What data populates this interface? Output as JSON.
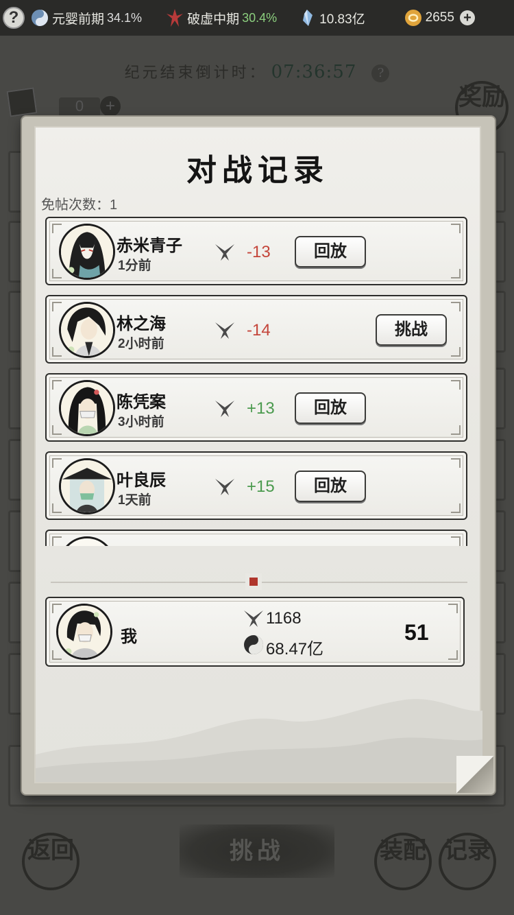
{
  "topbar": {
    "help_label": "?",
    "realm": {
      "label": "元婴前期",
      "percent": "34.1%",
      "icon": "yin-yang-icon"
    },
    "break": {
      "label": "破虚中期",
      "percent": "30.4%",
      "icon": "red-flame-icon"
    },
    "spirit_stone": {
      "value": "10.83亿",
      "icon": "crystal-icon"
    },
    "coins": {
      "value": "2655",
      "icon": "gold-coin-icon"
    },
    "plus_label": "+"
  },
  "background": {
    "countdown_label": "纪元结束倒计时：",
    "countdown_time": "07:36:57",
    "help_label": "?",
    "ticket_count": "0",
    "ticket_plus": "+",
    "reward_label": "奖励",
    "back_label": "返回",
    "challenge_label": "挑战",
    "equip_label": "装配",
    "records_label": "记录"
  },
  "modal": {
    "title": "对战记录",
    "free_label": "免帖次数：",
    "free_count": "1",
    "records": [
      {
        "name": "赤米青子",
        "time": "1分前",
        "delta": "-13",
        "sign": "neg",
        "action": "回放",
        "avatar": "fox-mask-avatar"
      },
      {
        "name": "林之海",
        "time": "2小时前",
        "delta": "-14",
        "sign": "neg",
        "action": "挑战",
        "avatar": "swordsman-avatar"
      },
      {
        "name": "陈凭案",
        "time": "3小时前",
        "delta": "+13",
        "sign": "pos",
        "action": "回放",
        "avatar": "masked-lady-avatar"
      },
      {
        "name": "叶良辰",
        "time": "1天前",
        "delta": "+15",
        "sign": "pos",
        "action": "回放",
        "avatar": "hat-veil-avatar"
      }
    ],
    "me": {
      "name": "我",
      "score": "1168",
      "power": "68.47亿",
      "rank": "51",
      "avatar": "player-avatar"
    }
  },
  "colors": {
    "negative": "#c4453a",
    "positive": "#4b9a4e",
    "seal": "#b0362c"
  }
}
